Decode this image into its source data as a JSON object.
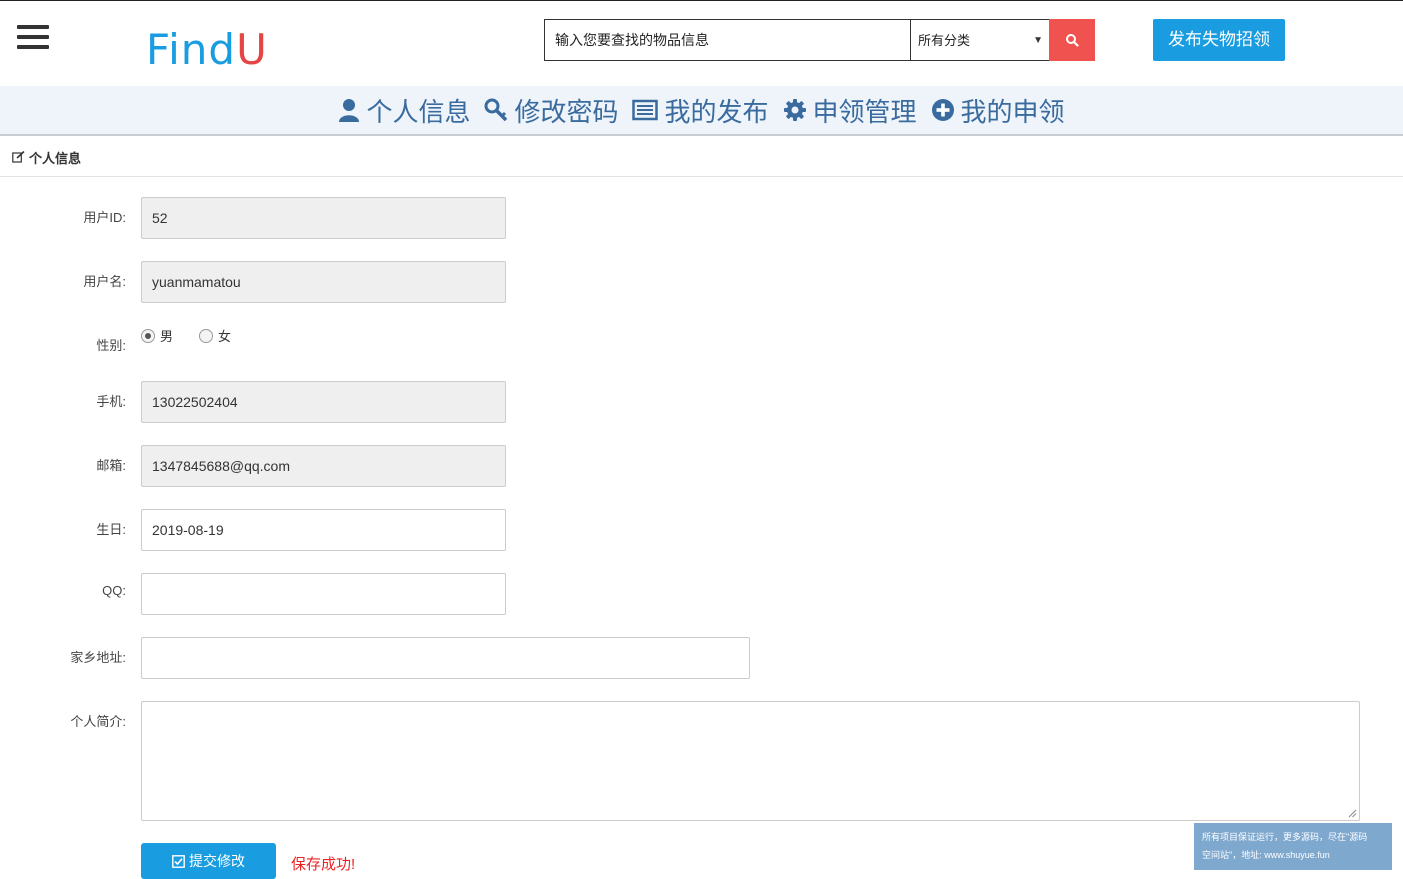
{
  "header": {
    "logo_part1": "Find",
    "logo_part2": "U",
    "search_placeholder": "输入您要查找的物品信息",
    "category_selected": "所有分类",
    "publish_label": "发布失物招领"
  },
  "nav": {
    "items": [
      {
        "label": "个人信息",
        "icon": "user-icon"
      },
      {
        "label": "修改密码",
        "icon": "key-icon"
      },
      {
        "label": "我的发布",
        "icon": "list-icon"
      },
      {
        "label": "申领管理",
        "icon": "gear-icon"
      },
      {
        "label": "我的申领",
        "icon": "plus-circle-icon"
      }
    ]
  },
  "section": {
    "title": "个人信息",
    "icon": "edit-icon"
  },
  "form": {
    "user_id": {
      "label": "用户ID:",
      "value": "52"
    },
    "username": {
      "label": "用户名:",
      "value": "yuanmamatou"
    },
    "gender": {
      "label": "性别:",
      "male": "男",
      "female": "女",
      "selected": "男"
    },
    "phone": {
      "label": "手机:",
      "value": "13022502404"
    },
    "email": {
      "label": "邮箱:",
      "value": "1347845688@qq.com"
    },
    "birthday": {
      "label": "生日:",
      "value": "2019-08-19"
    },
    "qq": {
      "label": "QQ:",
      "value": ""
    },
    "hometown": {
      "label": "家乡地址:",
      "value": ""
    },
    "bio": {
      "label": "个人简介:",
      "value": ""
    },
    "submit_label": "提交修改",
    "success_message": "保存成功!"
  },
  "notice": {
    "line1": "所有项目保证运行，更多源码，尽在\"源码",
    "line2": "空间站\"，地址: www.shuyue.fun"
  },
  "colors": {
    "brand_blue": "#1a9ce0",
    "accent_red": "#f0524f",
    "nav_text": "#3a6b9e"
  }
}
